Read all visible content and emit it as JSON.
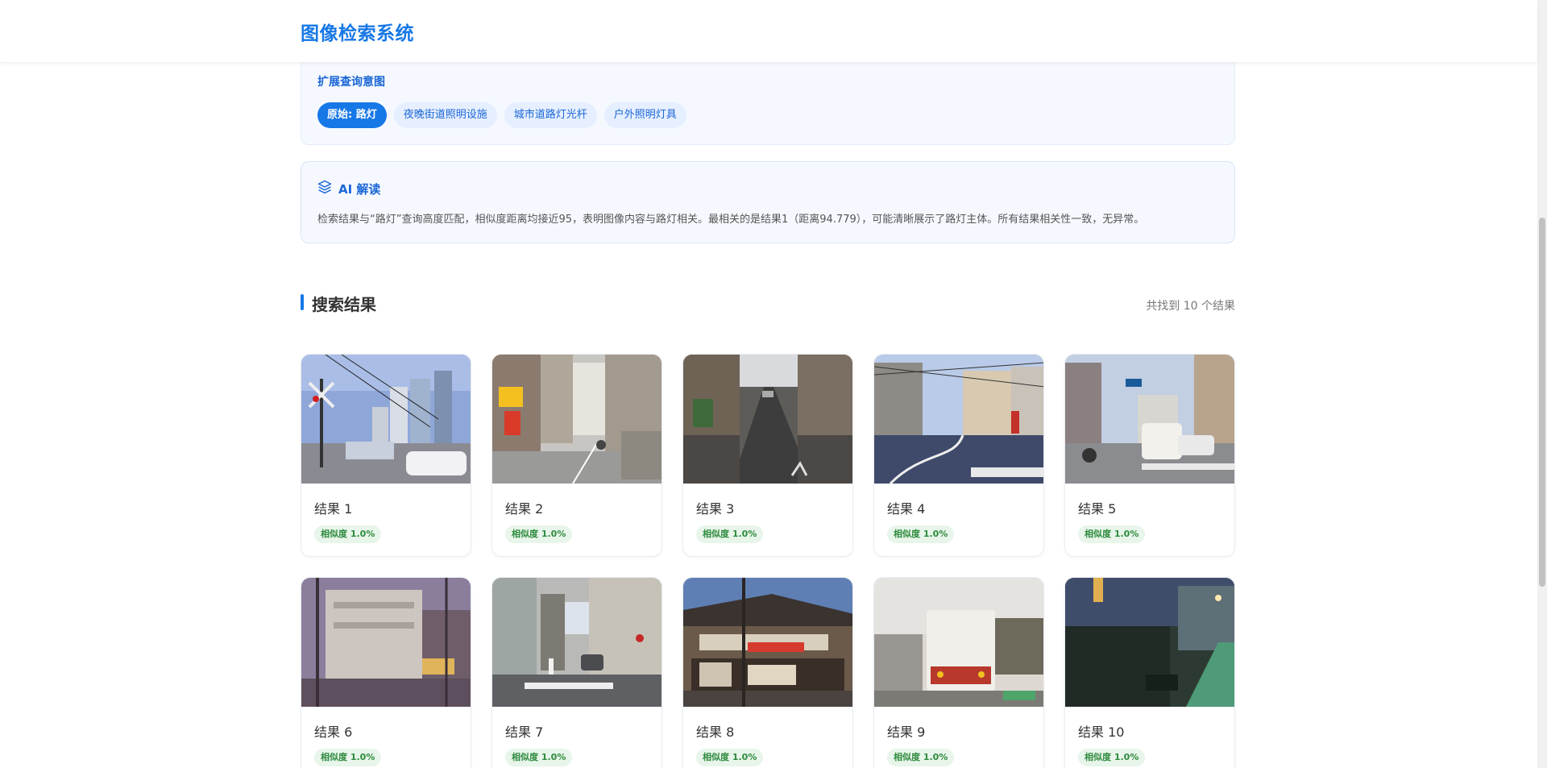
{
  "app": {
    "title": "图像检索系统"
  },
  "intent": {
    "title": "扩展查询意图",
    "chips": [
      "原始: 路灯",
      "夜晚街道照明设施",
      "城市道路灯光杆",
      "户外照明灯具"
    ]
  },
  "ai": {
    "title": "AI 解读",
    "text": "检索结果与“路灯”查询高度匹配，相似度距离均接近95，表明图像内容与路灯相关。最相关的是结果1（距离94.779），可能清晰展示了路灯主体。所有结果相关性一致，无异常。"
  },
  "results": {
    "title": "搜索结果",
    "count": "共找到 10 个结果",
    "items": [
      {
        "label": "结果 1",
        "score": "相似度 1.0%"
      },
      {
        "label": "结果 2",
        "score": "相似度 1.0%"
      },
      {
        "label": "结果 3",
        "score": "相似度 1.0%"
      },
      {
        "label": "结果 4",
        "score": "相似度 1.0%"
      },
      {
        "label": "结果 5",
        "score": "相似度 1.0%"
      },
      {
        "label": "结果 6",
        "score": "相似度 1.0%"
      },
      {
        "label": "结果 7",
        "score": "相似度 1.0%"
      },
      {
        "label": "结果 8",
        "score": "相似度 1.0%"
      },
      {
        "label": "结果 9",
        "score": "相似度 1.0%"
      },
      {
        "label": "结果 10",
        "score": "相似度 1.0%"
      }
    ]
  },
  "colors": {
    "accent": "#1677e6",
    "badge_bg": "#e8f5ea",
    "badge_text": "#2e8b3e"
  }
}
